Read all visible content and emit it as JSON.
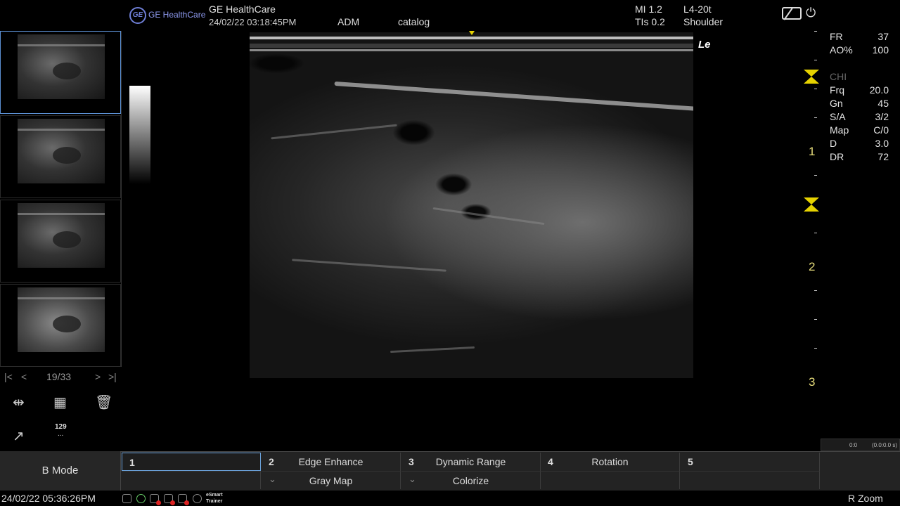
{
  "header": {
    "brand_mark": "GE",
    "brand_small": "GE HealthCare",
    "company": "GE HealthCare",
    "datetime": "24/02/22 03:18:45PM",
    "user": "ADM",
    "patient": "catalog",
    "mi": "MI 1.2",
    "tis": "TIs 0.2",
    "probe": "L4-20t",
    "preset": "Shoulder"
  },
  "thumbnails": {
    "count_label": "19/33",
    "pager": {
      "first": "|<",
      "prev": "<",
      "next": ">",
      "last": ">|"
    }
  },
  "left_tools": {
    "count": "129",
    "more": "..."
  },
  "image": {
    "orientation_label": "Le",
    "depth_labels": [
      "1",
      "2",
      "3"
    ]
  },
  "params": [
    {
      "k": "FR",
      "v": "37"
    },
    {
      "k": "AO%",
      "v": "100"
    },
    {
      "k": "",
      "v": ""
    },
    {
      "k": "CHI",
      "v": "",
      "dim": true
    },
    {
      "k": "Frq",
      "v": "20.0"
    },
    {
      "k": "Gn",
      "v": "45"
    },
    {
      "k": "S/A",
      "v": "3/2"
    },
    {
      "k": "Map",
      "v": "C/0"
    },
    {
      "k": "D",
      "v": "3.0"
    },
    {
      "k": "DR",
      "v": "72"
    }
  ],
  "cine": {
    "frame": "0:0",
    "time": "(0.0:0.0 s)"
  },
  "bottom": {
    "mode": "B Mode",
    "top": [
      {
        "num": "1",
        "label": ""
      },
      {
        "num": "2",
        "label": "Edge Enhance"
      },
      {
        "num": "3",
        "label": "Dynamic Range"
      },
      {
        "num": "4",
        "label": "Rotation"
      },
      {
        "num": "5",
        "label": ""
      }
    ],
    "lower": [
      {
        "label": ""
      },
      {
        "label": "Gray Map"
      },
      {
        "label": "Colorize"
      },
      {
        "label": ""
      },
      {
        "label": ""
      }
    ]
  },
  "status": {
    "datetime": "24/02/22 05:36:26PM",
    "trainer_1": "eSmart",
    "trainer_2": "Trainer",
    "zoom": "R Zoom"
  },
  "colors": {
    "accent": "#e6d200",
    "selection": "#5b8fd2"
  }
}
